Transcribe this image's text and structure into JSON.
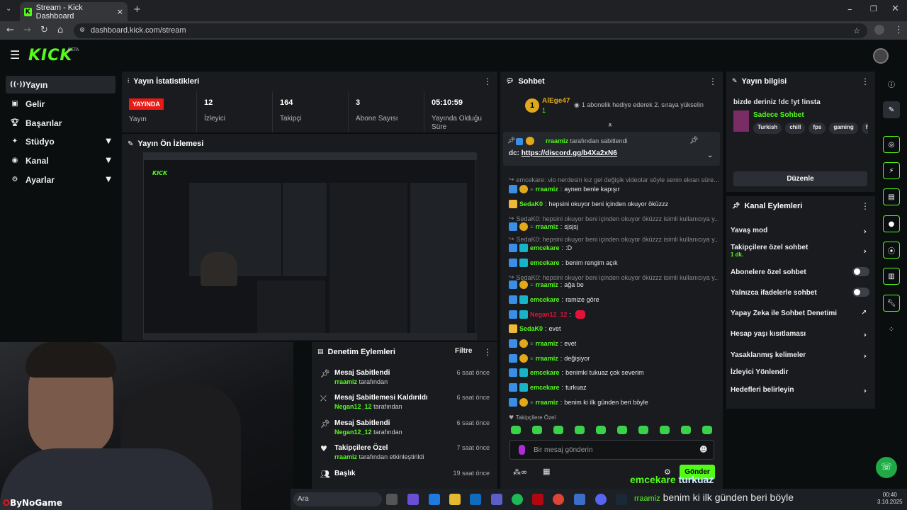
{
  "browser": {
    "tab_title": "Stream - Kick Dashboard",
    "url": "dashboard.kick.com/stream"
  },
  "brand": {
    "logo": "KICK",
    "beta": "BETA",
    "accent": "#53fc18"
  },
  "sidebar": {
    "items": [
      {
        "label": "Yayın",
        "icon": "broadcast-icon",
        "active": true
      },
      {
        "label": "Gelir",
        "icon": "revenue-icon"
      },
      {
        "label": "Başarılar",
        "icon": "trophy-icon"
      },
      {
        "label": "Stüdyo",
        "icon": "studio-icon"
      },
      {
        "label": "Kanal",
        "icon": "channel-icon"
      },
      {
        "label": "Ayarlar",
        "icon": "gear-icon"
      }
    ]
  },
  "stats": {
    "title": "Yayın İstatistikleri",
    "live_badge": "YAYINDA",
    "live_label": "Yayın",
    "viewers": {
      "value": "12",
      "label": "İzleyici"
    },
    "followers": {
      "value": "164",
      "label": "Takipçi"
    },
    "subs": {
      "value": "3",
      "label": "Abone Sayısı"
    },
    "duration": {
      "value": "05:10:59",
      "label": "Yayında Olduğu Süre"
    }
  },
  "preview": {
    "title": "Yayın Ön İzlemesi"
  },
  "mod_actions": {
    "title": "Denetim Eylemleri",
    "filter": "Filtre",
    "items": [
      {
        "title": "Mesaj Sabitlendi",
        "user": "rraamiz",
        "suffix": "tarafından",
        "time": "6 saat önce",
        "icon": "pin-icon"
      },
      {
        "title": "Mesaj Sabitlemesi Kaldırıldı",
        "user": "Negan12_12",
        "suffix": "tarafından",
        "time": "6 saat önce",
        "icon": "unpin-icon"
      },
      {
        "title": "Mesaj Sabitlendi",
        "user": "Negan12_12",
        "suffix": "tarafından",
        "time": "6 saat önce",
        "icon": "pin-icon"
      },
      {
        "title": "Takipçilere Özel",
        "user": "rraamiz",
        "suffix": "tarafından etkinleştirildi",
        "time": "7 saat önce",
        "icon": "heart-icon"
      },
      {
        "title": "Başlık",
        "user": "",
        "suffix": "",
        "time": "19 saat önce",
        "icon": "people-icon"
      }
    ]
  },
  "chat": {
    "title": "Sohbet",
    "gift_user": "AlEge47",
    "gift_count": "1",
    "gift_text": "1 abonelik hediye ederek 2. sıraya yükselin",
    "pinned_by": "rraamiz",
    "pinned_suffix": "tarafından sabitlendi",
    "pinned_prefix": "dc:",
    "pinned_link": "https://discord.gg/b4Xa2xN6",
    "messages": [
      {
        "type": "sys",
        "text": "emcekare: vio nerdesin kız gel değişik videolar söyle senin ekran süre..."
      },
      {
        "user": "rraamiz",
        "color": "#53fc18",
        "text": "aynen benle kapışır",
        "badges": [
          "blue",
          "gold",
          "mod"
        ]
      },
      {
        "user": "SedaK0",
        "color": "#53fc18",
        "text": "hepsini okuyor beni içinden okuyor öküzzz",
        "badges": [
          "crown"
        ]
      },
      {
        "type": "sys",
        "text": "SedaK0: hepsini okuyor beni içinden okuyor öküzzz isimli kullanıcıya y..."
      },
      {
        "user": "rraamiz",
        "color": "#53fc18",
        "text": "sjsjsj",
        "badges": [
          "blue",
          "gold",
          "mod"
        ]
      },
      {
        "type": "sys",
        "text": "SedaK0: hepsini okuyor beni içinden okuyor öküzzz isimli kullanıcıya y..."
      },
      {
        "user": "emcekare",
        "color": "#53fc18",
        "text": ":D",
        "badges": [
          "blue",
          "teal"
        ]
      },
      {
        "user": "emcekare",
        "color": "#53fc18",
        "text": "benim rengim açık",
        "badges": [
          "blue",
          "teal"
        ]
      },
      {
        "type": "sys",
        "text": "SedaK0: hepsini okuyor beni içinden okuyor öküzzz isimli kullanıcıya y..."
      },
      {
        "user": "rraamiz",
        "color": "#53fc18",
        "text": "ağa be",
        "badges": [
          "blue",
          "gold",
          "mod"
        ]
      },
      {
        "user": "emcekare",
        "color": "#53fc18",
        "text": "ramize göre",
        "badges": [
          "blue",
          "teal"
        ]
      },
      {
        "user": "Negan12_12",
        "color": "#e2123b",
        "text": "",
        "badges": [
          "blue",
          "teal"
        ],
        "emote": true
      },
      {
        "user": "SedaK0",
        "color": "#53fc18",
        "text": "evet",
        "badges": [
          "crown"
        ]
      },
      {
        "user": "rraamiz",
        "color": "#53fc18",
        "text": "evet",
        "badges": [
          "blue",
          "gold",
          "mod"
        ]
      },
      {
        "user": "rraamiz",
        "color": "#53fc18",
        "text": "değişiyor",
        "badges": [
          "blue",
          "gold",
          "mod"
        ]
      },
      {
        "user": "emcekare",
        "color": "#53fc18",
        "text": "benimki tukuaz çok severim",
        "badges": [
          "blue",
          "teal"
        ]
      },
      {
        "user": "emcekare",
        "color": "#53fc18",
        "text": "turkuaz",
        "badges": [
          "blue",
          "teal"
        ]
      },
      {
        "user": "rraamiz",
        "color": "#53fc18",
        "text": "benim ki ilk günden beri böyle",
        "badges": [
          "blue",
          "gold",
          "mod"
        ]
      }
    ],
    "followers_only": "Takipçilere Özel",
    "input_placeholder": "Bir mesaj gönderin",
    "send_label": "Gönder"
  },
  "stream_info": {
    "title": "Yayın bilgisi",
    "stream_title": "bizde deriniz !dc !yt !insta",
    "category": "Sadece Sohbet",
    "tags": [
      "Turkish",
      "chill",
      "fps",
      "gaming",
      "fu"
    ],
    "edit_label": "Düzenle"
  },
  "channel_actions": {
    "title": "Kanal Eylemleri",
    "items": [
      {
        "label": "Yavaş mod",
        "control": "chevron"
      },
      {
        "label": "Takipçilere özel sohbet",
        "sub": "1 dk.",
        "control": "chevron"
      },
      {
        "label": "Abonelere özel sohbet",
        "control": "toggle"
      },
      {
        "label": "Yalnızca ifadelerle sohbet",
        "control": "toggle"
      },
      {
        "label": "Yapay Zeka ile Sohbet Denetimi",
        "control": "external"
      },
      {
        "label": "Hesap yaşı kısıtlaması",
        "control": "chevron"
      },
      {
        "label": "Yasaklanmış kelimeler",
        "control": "chevron"
      },
      {
        "label": "İzleyici Yönlendir",
        "control": "none"
      },
      {
        "label": "Hedefleri belirleyin",
        "control": "chevron"
      }
    ]
  },
  "overlay": {
    "watermark": "ByNoGame",
    "caption_user": "emcekare",
    "caption_text": "turkuaz",
    "caption2_user": "rraamiz",
    "caption2_text": "benim ki ilk günden beri böyle"
  },
  "taskbar": {
    "search": "Ara",
    "time": "00:40",
    "date": "3.10.2025"
  }
}
